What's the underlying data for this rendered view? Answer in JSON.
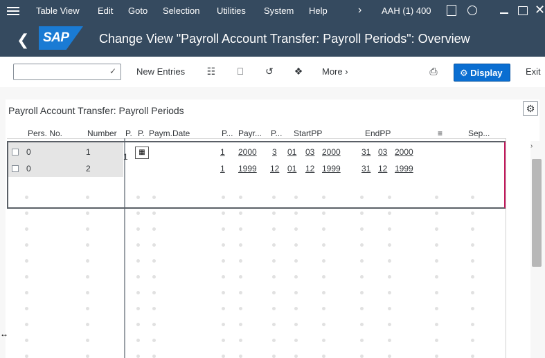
{
  "menu": {
    "items": [
      "Table View",
      "Edit",
      "Goto",
      "Selection",
      "Utilities",
      "System",
      "Help"
    ],
    "system_info": "AAH (1) 400",
    "icons": [
      "menu-icon",
      "chevron-right-icon",
      "save-icon",
      "share-icon",
      "minimize-icon",
      "maximize-icon",
      "close-icon"
    ]
  },
  "titlebar": {
    "logo": "SAP",
    "title": "Change View \"Payroll Account Transfer: Payroll Periods\": Overview"
  },
  "toolbar": {
    "dropdown_value": "",
    "new_entries": "New Entries",
    "more": "More",
    "display": "Display",
    "exit": "Exit"
  },
  "table": {
    "caption": "Payroll Account Transfer: Payroll Periods",
    "headers": [
      "Pers. No.",
      "Number",
      "P.",
      "P.",
      "Paym.Date",
      "P...",
      "Payr...",
      "P...",
      "StartPP",
      "EndPP",
      "Sep..."
    ],
    "rows": [
      {
        "pers_no": "0",
        "number": "1",
        "p1": "1",
        "p2": "1",
        "payr": "2000",
        "p3": "3",
        "start_d": "01",
        "start_m": "03",
        "start_y": "2000",
        "end_d": "31",
        "end_m": "03",
        "end_y": "2000"
      },
      {
        "pers_no": "0",
        "number": "2",
        "p1": "",
        "p2": "1",
        "payr": "1999",
        "p3": "12",
        "start_d": "01",
        "start_m": "12",
        "start_y": "1999",
        "end_d": "31",
        "end_m": "12",
        "end_y": "1999"
      }
    ]
  },
  "colors": {
    "shell": "#354a5f",
    "brand": "#1a7bd4",
    "emphasized_button": "#0a6ed1",
    "row_highlight_border": "#5a5f66"
  }
}
